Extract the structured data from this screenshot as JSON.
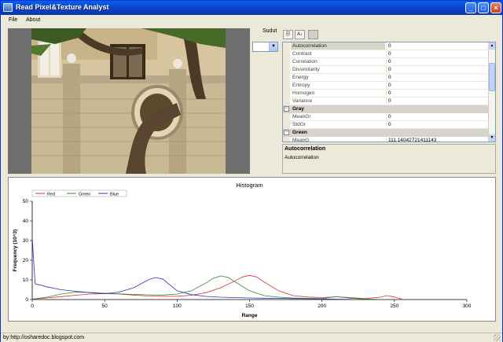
{
  "window": {
    "title": "Read Pixel&Texture Analyst",
    "icon": "window-icon"
  },
  "menu": {
    "items": [
      "File",
      "About"
    ]
  },
  "controls": {
    "sudut_label": "Sudut",
    "sudut_value": ""
  },
  "propgrid": {
    "rows": [
      {
        "kind": "prop",
        "name": "Autocorrelation",
        "value": "0",
        "selected": true
      },
      {
        "kind": "prop",
        "name": "Contrast",
        "value": "0"
      },
      {
        "kind": "prop",
        "name": "Correlation",
        "value": "0"
      },
      {
        "kind": "prop",
        "name": "Dissimilarity",
        "value": "0"
      },
      {
        "kind": "prop",
        "name": "Energy",
        "value": "0"
      },
      {
        "kind": "prop",
        "name": "Entropy",
        "value": "0"
      },
      {
        "kind": "prop",
        "name": "Homogen",
        "value": "0"
      },
      {
        "kind": "prop",
        "name": "Variance",
        "value": "0"
      },
      {
        "kind": "category",
        "name": "Gray"
      },
      {
        "kind": "prop",
        "name": "MeanGr",
        "value": "0"
      },
      {
        "kind": "prop",
        "name": "StdGr",
        "value": "0"
      },
      {
        "kind": "category",
        "name": "Green"
      },
      {
        "kind": "prop",
        "name": "MeanG",
        "value": "111.14042721411143"
      }
    ],
    "description": {
      "title": "Autocorrelation",
      "text": "Autocorrelation"
    }
  },
  "chart_data": {
    "type": "line",
    "title": "Histogram",
    "xlabel": "Range",
    "ylabel": "Frequency (10^3)",
    "xlim": [
      0,
      300
    ],
    "ylim": [
      0,
      50
    ],
    "xticks": [
      0,
      50,
      100,
      150,
      200,
      250,
      300
    ],
    "yticks": [
      0,
      10,
      20,
      30,
      40,
      50
    ],
    "legend": "top-left",
    "grid": false,
    "series": [
      {
        "name": "Red",
        "color": "#e03030",
        "x": [
          0,
          10,
          20,
          30,
          40,
          50,
          60,
          70,
          80,
          90,
          100,
          110,
          120,
          130,
          140,
          145,
          150,
          155,
          160,
          170,
          180,
          190,
          200,
          210,
          220,
          230,
          240,
          245,
          250,
          255
        ],
        "y": [
          0.3,
          0.8,
          1.5,
          2.2,
          2.8,
          3.0,
          2.8,
          2.3,
          1.8,
          1.6,
          1.7,
          2.2,
          3.5,
          6.0,
          9.5,
          11.5,
          12.3,
          11.5,
          9.0,
          4.5,
          2.0,
          1.3,
          1.0,
          1.4,
          1.0,
          0.5,
          1.2,
          2.0,
          1.3,
          0.3
        ]
      },
      {
        "name": "Green",
        "color": "#2e8b2e",
        "x": [
          0,
          10,
          20,
          30,
          40,
          50,
          60,
          70,
          80,
          90,
          100,
          110,
          120,
          125,
          130,
          135,
          140,
          150,
          160,
          170,
          180,
          190,
          200,
          210,
          220,
          230,
          240
        ],
        "y": [
          0.2,
          1.2,
          2.8,
          3.8,
          3.6,
          3.2,
          2.9,
          2.6,
          2.4,
          2.3,
          2.8,
          4.5,
          8.5,
          10.8,
          12.0,
          11.3,
          9.0,
          4.5,
          2.0,
          1.2,
          0.8,
          0.6,
          0.5,
          1.5,
          0.7,
          0.3,
          0.1
        ]
      },
      {
        "name": "Blue",
        "color": "#3030d0",
        "x": [
          0,
          1,
          2,
          5,
          10,
          20,
          30,
          40,
          50,
          60,
          70,
          75,
          80,
          85,
          90,
          95,
          100,
          110,
          120,
          130,
          140,
          150,
          160,
          170,
          180,
          190,
          200,
          210,
          220
        ],
        "y": [
          32,
          20,
          8,
          7.5,
          6.5,
          5.0,
          4.2,
          3.5,
          3.0,
          3.8,
          6.0,
          8.0,
          10.0,
          11.2,
          10.5,
          7.5,
          4.5,
          2.5,
          1.6,
          1.2,
          1.0,
          0.8,
          0.7,
          0.6,
          0.5,
          0.4,
          0.3,
          0.2,
          0.1
        ]
      }
    ]
  },
  "status": {
    "text": "by:http://osharedoc.blogspot.com"
  }
}
